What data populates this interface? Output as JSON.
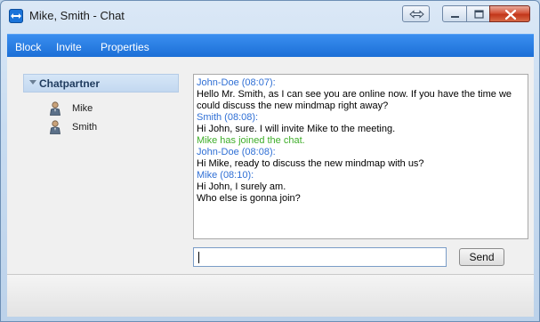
{
  "window": {
    "title": "Mike, Smith - Chat"
  },
  "menu": {
    "items": [
      {
        "label": "Block"
      },
      {
        "label": "Invite"
      },
      {
        "label": "Properties"
      }
    ]
  },
  "sidebar": {
    "group_label": "Chatpartner",
    "contacts": [
      {
        "name": "Mike",
        "icon": "person-icon"
      },
      {
        "name": "Smith",
        "icon": "person-icon"
      }
    ]
  },
  "chat": {
    "lines": [
      {
        "kind": "head",
        "text": "John-Doe (08:07):"
      },
      {
        "kind": "text",
        "text": "Hello Mr. Smith, as I can see you are online now. If you have the time we"
      },
      {
        "kind": "text",
        "text": "could discuss the new mindmap right away?"
      },
      {
        "kind": "head",
        "text": "Smith (08:08):"
      },
      {
        "kind": "text",
        "text": "Hi John, sure. I will invite Mike to the meeting."
      },
      {
        "kind": "sys",
        "text": "Mike has joined the chat."
      },
      {
        "kind": "head",
        "text": "John-Doe (08:08):"
      },
      {
        "kind": "text",
        "text": "Hi Mike, ready to discuss the new mindmap with us?"
      },
      {
        "kind": "head",
        "text": "Mike (08:10):"
      },
      {
        "kind": "text",
        "text": "Hi John, I surely am."
      },
      {
        "kind": "text",
        "text": "Who else is gonna join?"
      }
    ],
    "input_value": "",
    "send_label": "Send"
  },
  "colors": {
    "menubar": "#1c6fd6",
    "message_head": "#2f6fd5",
    "system_message": "#3fae2a"
  }
}
